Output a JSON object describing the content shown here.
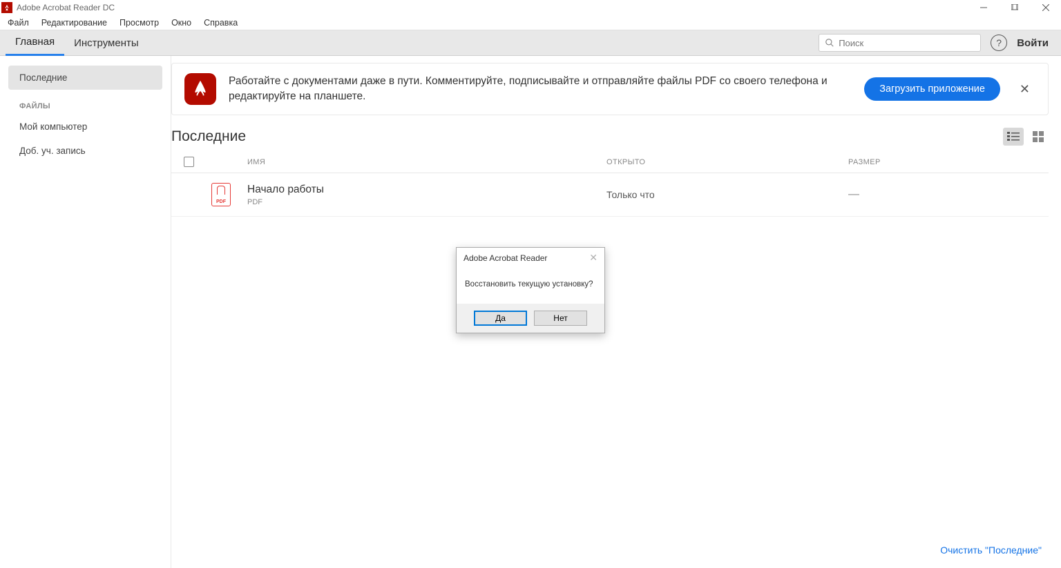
{
  "titlebar": {
    "app_name": "Adobe Acrobat Reader DC"
  },
  "menu": {
    "items": [
      "Файл",
      "Редактирование",
      "Просмотр",
      "Окно",
      "Справка"
    ]
  },
  "toolbar": {
    "tabs": [
      "Главная",
      "Инструменты"
    ],
    "search_placeholder": "Поиск",
    "login_label": "Войти"
  },
  "sidebar": {
    "recent": "Последние",
    "section_files": "ФАЙЛЫ",
    "my_computer": "Мой компьютер",
    "add_account": "Доб. уч. запись"
  },
  "banner": {
    "text": "Работайте с документами даже в пути. Комментируйте, подписывайте и отправляйте файлы PDF со своего телефона и редактируйте на планшете.",
    "button": "Загрузить приложение"
  },
  "recent": {
    "title": "Последние",
    "col_name": "ИМЯ",
    "col_opened": "ОТКРЫТО",
    "col_size": "РАЗМЕР",
    "files": [
      {
        "name": "Начало работы",
        "type": "PDF",
        "opened": "Только что",
        "size": "—",
        "icon_label": "PDF"
      }
    ]
  },
  "footer": {
    "clear_recent": "Очистить \"Последние\""
  },
  "dialog": {
    "title": "Adobe Acrobat Reader",
    "message": "Восстановить текущую установку?",
    "yes": "Да",
    "no": "Нет"
  }
}
